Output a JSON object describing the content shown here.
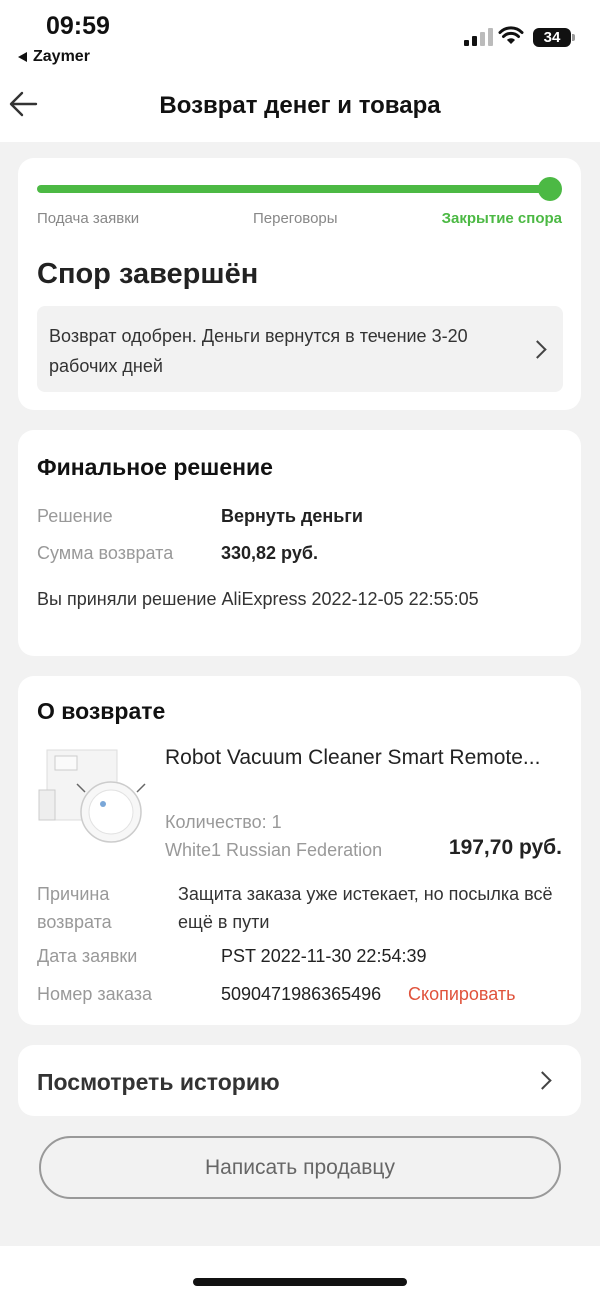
{
  "status_bar": {
    "time": "09:59",
    "back_app": "Zaymer",
    "battery": "34",
    "icons": [
      "cellular-signal-icon",
      "wifi-icon",
      "battery-icon"
    ]
  },
  "nav": {
    "title": "Возврат денег и товара",
    "back_icon": "arrow-left-icon"
  },
  "progress": {
    "steps": [
      "Подача заявки",
      "Переговоры",
      "Закрытие спора"
    ],
    "active_step": 2,
    "fraction": 1.0,
    "color": "#4cb944"
  },
  "dispute": {
    "title": "Спор завершён",
    "notice": "Возврат одобрен. Деньги вернутся в течение 3-20 рабочих дней"
  },
  "final_decision": {
    "title": "Финальное решение",
    "decision_label": "Решение",
    "decision_value": "Вернуть деньги",
    "amount_label": "Сумма возврата",
    "amount_value": "330,82 руб.",
    "accepted_text": "Вы приняли решение AliExpress 2022-12-05 22:55:05"
  },
  "return_info": {
    "title": "О возврате",
    "product_name": "Robot Vacuum Cleaner Smart Remote...",
    "quantity": "Количество: 1",
    "variant": "White1 Russian Federation",
    "price": "197,70 руб.",
    "reason_label": "Причина возврата",
    "reason_value": "Защита заказа уже истекает, но посылка всё ещё в пути",
    "date_label": "Дата заявки",
    "date_value": "PST 2022-11-30 22:54:39",
    "order_label": "Номер заказа",
    "order_value": "5090471986365496",
    "copy_label": "Скопировать"
  },
  "history": {
    "label": "Посмотреть историю"
  },
  "actions": {
    "contact_seller": "Написать продавцу"
  },
  "colors": {
    "accent_green": "#4cb944",
    "link_red": "#e0533c"
  }
}
